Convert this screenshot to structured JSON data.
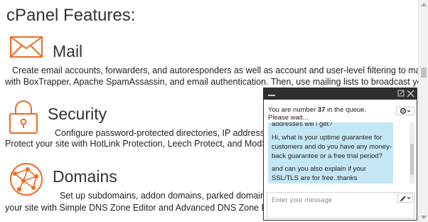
{
  "page": {
    "heading": "cPanel Features:"
  },
  "features": [
    {
      "title": "Mail",
      "icon": "envelope-icon",
      "desc_line1": "Create email accounts, forwarders, and autoresponders as well as account and user-level filtering to man",
      "desc_line2": "with BoxTrapper, Apache SpamAssassin, and email authentication. Then, use mailing lists to broadcast yo"
    },
    {
      "title": "Security",
      "icon": "padlock-icon",
      "desc_line1": "Configure password-protected directories, IP address",
      "desc_line2": "Protect your site with HotLink Protection, Leech Protect, and ModS"
    },
    {
      "title": "Domains",
      "icon": "globe-network-icon",
      "desc_line1": "Set up subdomains, addon domains, parked domains",
      "desc_line2": "your site with Simple DNS Zone Editor and Advanced DNS Zone E"
    }
  ],
  "chat": {
    "queue_prefix": "You are number ",
    "queue_number": "37",
    "queue_suffix": " in the queue.",
    "queue_wait": "Please wait...",
    "message_lines": [
      "addresses will i get?",
      "Hi, what is your uptime guarantee for",
      "customers and do you have any money-",
      "back guarantee or a free trial period?",
      "and can you also explain if your",
      "SSL/TLS are for free..thanks"
    ],
    "input_placeholder": "Enter your message"
  },
  "colors": {
    "accent_orange": "#f06a24",
    "chat_titlebar": "#2f2f2f",
    "chat_bubble": "#c5e7f5"
  }
}
